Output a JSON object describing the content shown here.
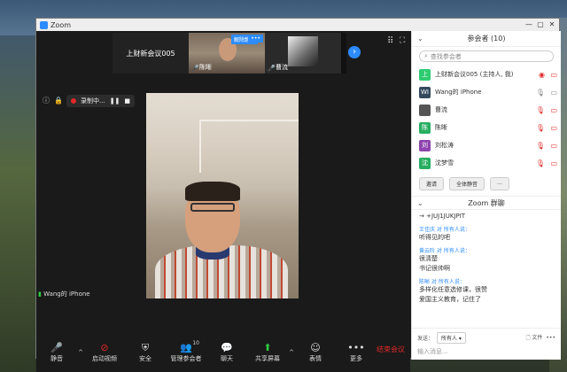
{
  "window": {
    "title": "Zoom",
    "controls": [
      "—",
      "▢",
      "✕"
    ]
  },
  "strip": {
    "meeting_name": "上财新会议005",
    "tiles": [
      {
        "name": "陈晰",
        "badge": "解除静音",
        "more": "•••"
      },
      {
        "name": "曹流"
      }
    ]
  },
  "recording": {
    "label": "录制中...",
    "pause": "❚❚",
    "stop": "■"
  },
  "main_video": {
    "label": "Wang的 iPhone"
  },
  "toolbar": {
    "items": [
      {
        "label": "静音",
        "icon": "microphone-icon"
      },
      {
        "label": "启动视频",
        "icon": "video-off-icon"
      },
      {
        "label": "安全",
        "icon": "shield-icon"
      },
      {
        "label": "管理参会者",
        "icon": "participants-icon",
        "count": "10"
      },
      {
        "label": "聊天",
        "icon": "chat-icon"
      },
      {
        "label": "共享屏幕",
        "icon": "share-screen-icon"
      },
      {
        "label": "表情",
        "icon": "emoji-icon"
      },
      {
        "label": "更多",
        "icon": "more-icon"
      }
    ],
    "end_label": "结束会议"
  },
  "participants": {
    "title": "参会者 (10)",
    "search_placeholder": "查找参会者",
    "list": [
      {
        "initial": "上",
        "name": "上财新会议005 (主持人, 我)",
        "color": "#2ecc71",
        "mic": "on",
        "cam": "off"
      },
      {
        "initial": "WI",
        "name": "Wang的 iPhone",
        "color": "#34495e",
        "mic": "on",
        "cam": "on"
      },
      {
        "initial": "",
        "name": "曹流",
        "color": "#555555",
        "mic": "muted",
        "cam": "off"
      },
      {
        "initial": "陈",
        "name": "陈晰",
        "color": "#27ae60",
        "mic": "muted",
        "cam": "off"
      },
      {
        "initial": "刘",
        "name": "刘松涛",
        "color": "#8e44ad",
        "mic": "muted",
        "cam": "off"
      },
      {
        "initial": "沈",
        "name": "沈梦雪",
        "color": "#27ae60",
        "mic": "muted",
        "cam": "off"
      }
    ],
    "invite_label": "邀请",
    "mute_all_label": "全体静音",
    "more_label": "..."
  },
  "chat": {
    "title": "Zoom 群聊",
    "messages": [
      {
        "from": "",
        "text": "→ +JUJ1JUKJPIT"
      },
      {
        "from": "王佳庆 对 所有人说：",
        "text": "听得见的吧"
      },
      {
        "from": "黄云阶 对 所有人说：",
        "text": "很清楚\n书记很帅啊"
      },
      {
        "from": "陈晰 对 所有人说：",
        "text": "多样化任意选修课，很赞\n爱国主义教育，记住了"
      }
    ],
    "to_label": "发送：",
    "to_value": "所有人 ▾",
    "file_label": "文件",
    "input_placeholder": "输入消息..."
  }
}
